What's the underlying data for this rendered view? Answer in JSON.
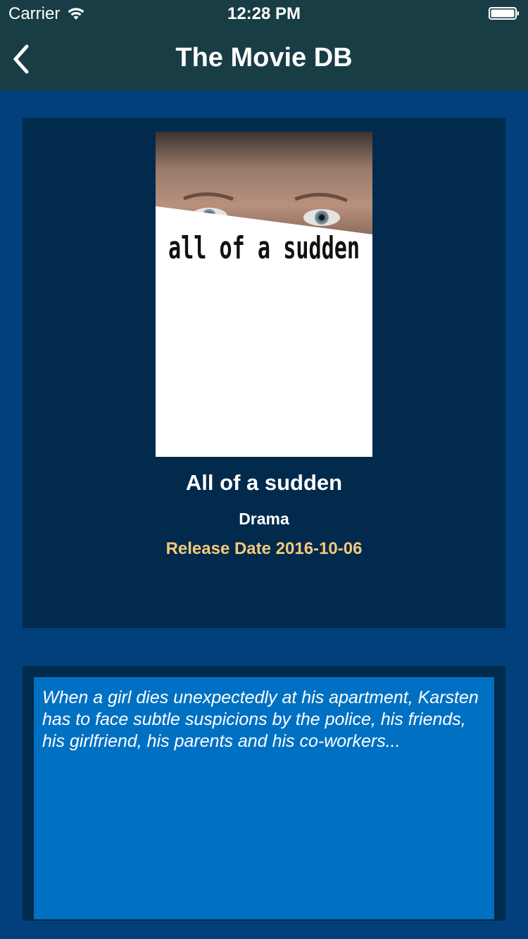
{
  "status_bar": {
    "carrier": "Carrier",
    "time": "12:28 PM",
    "icons": [
      "wifi-icon",
      "battery-icon"
    ]
  },
  "nav": {
    "title": "The Movie DB",
    "back_icon": "chevron-left-icon"
  },
  "movie": {
    "poster_title_text": "all of a sudden",
    "title": "All of a sudden",
    "genre": "Drama",
    "release_date": "Release Date 2016-10-06",
    "overview": "When a girl dies unexpectedly at his apartment, Karsten has to face subtle suspicions by the police, his friends, his girlfriend, his parents and his co-workers..."
  },
  "colors": {
    "nav_bg": "#193d44",
    "page_bg": "#01407a",
    "card_bg": "#012a4d",
    "overview_bg": "#0070c3",
    "release_date": "#f3c97a"
  }
}
